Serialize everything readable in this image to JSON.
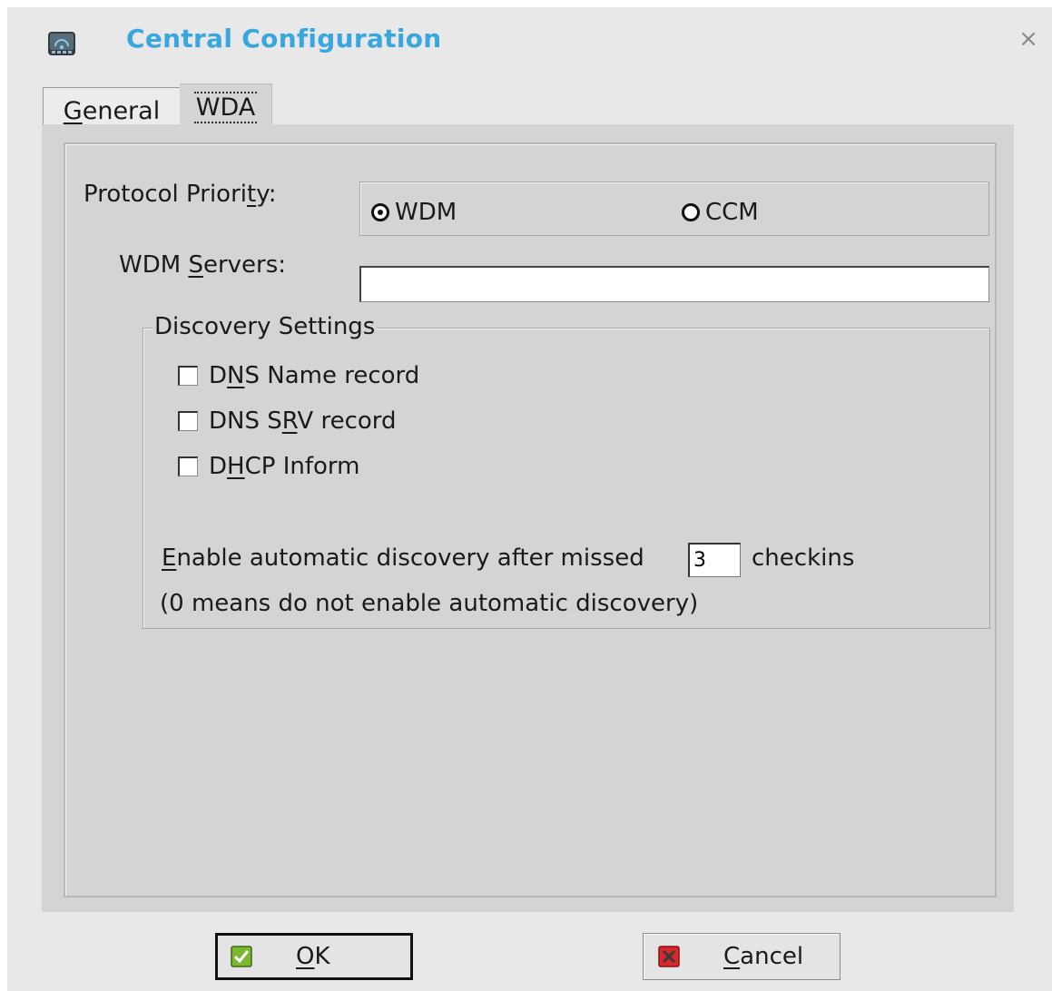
{
  "window": {
    "title": "Central Configuration",
    "app_icon": "network-terminal-icon",
    "close_icon": "close-icon",
    "close_glyph": "×"
  },
  "tabs": [
    {
      "label": "General",
      "mnemonic": "G",
      "rest": "eneral",
      "selected": false
    },
    {
      "label": "WDA",
      "selected": true
    }
  ],
  "protocol": {
    "label_pre": "Protocol Priori",
    "label_mn": "t",
    "label_post": "y:",
    "options": [
      {
        "label": "WDM",
        "checked": true
      },
      {
        "label": "CCM",
        "checked": false
      }
    ]
  },
  "wdm_servers": {
    "label_pre": "WDM ",
    "label_mn": "S",
    "label_post": "ervers:",
    "value": ""
  },
  "discovery": {
    "title": "Discovery Settings",
    "checks": [
      {
        "pre": "D",
        "mn": "N",
        "post": "S Name record",
        "checked": false
      },
      {
        "pre": "DNS S",
        "mn": "R",
        "post": "V record",
        "checked": false
      },
      {
        "pre": "D",
        "mn": "H",
        "post": "CP Inform",
        "checked": false
      }
    ],
    "missed_mn": "E",
    "missed_pre": "nable automatic discovery after missed",
    "missed_value": "3",
    "missed_post": "checkins",
    "note": "(0 means do not enable automatic discovery)"
  },
  "buttons": {
    "ok_mn": "O",
    "ok_rest": "K",
    "ok_icon": "check-icon",
    "cancel_mn": "C",
    "cancel_rest": "ancel",
    "cancel_icon": "cancel-x-icon"
  },
  "colors": {
    "title": "#39a7df",
    "dialog_bg": "#e8e8e8",
    "panel_bg": "#d4d4d4",
    "ok_check": "#7cb82f",
    "cancel_x": "#d9262c"
  }
}
